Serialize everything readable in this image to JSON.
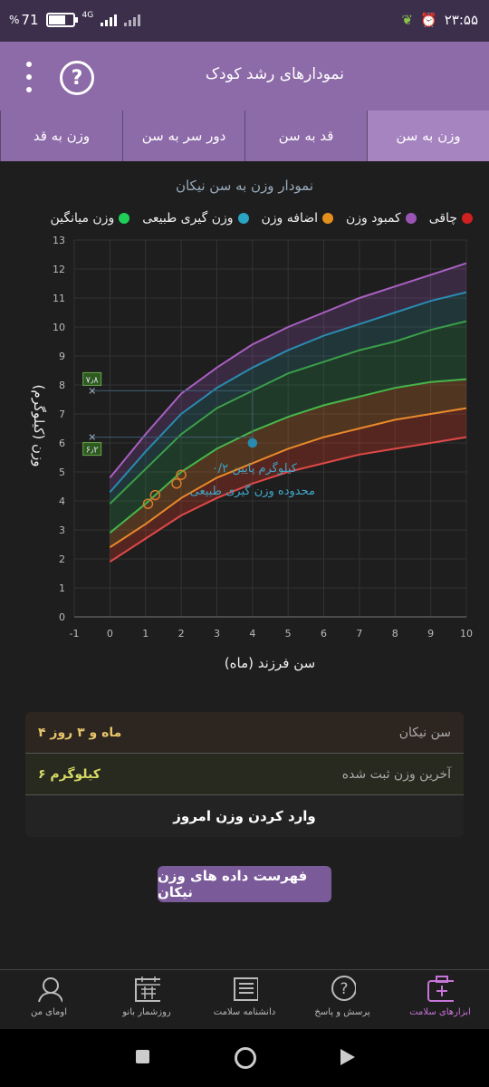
{
  "status": {
    "battery": "71",
    "battery_symbol": "%",
    "network": "4G",
    "clock": "۲۳:۵۵"
  },
  "header": {
    "title": "نمودارهای رشد کودک",
    "help_symbol": "?"
  },
  "tabs": [
    {
      "label": "وزن به سن",
      "active": true
    },
    {
      "label": "قد به سن",
      "active": false
    },
    {
      "label": "دور سر به سن",
      "active": false
    },
    {
      "label": "وزن به قد",
      "active": false
    }
  ],
  "chart": {
    "title": "نمودار وزن به سن نیکان"
  },
  "legend": [
    {
      "label": "چاقی",
      "color": "#d12020"
    },
    {
      "label": "کمبود وزن",
      "color": "#e5901c"
    },
    {
      "label": "اضافه وزن",
      "color": "#2aa4c2"
    },
    {
      "label": "وزن گیری طبیعی",
      "color": "#1fcf57"
    },
    {
      "label": "وزن میانگین",
      "color": "#4a4a4a"
    }
  ],
  "chart_data": {
    "type": "line",
    "xlabel": "سن فرزند (ماه)",
    "ylabel": "وزن (کیلوگرم)",
    "xlim": [
      -1,
      10
    ],
    "ylim": [
      0,
      13
    ],
    "x": [
      0,
      1,
      2,
      3,
      4,
      5,
      6,
      7,
      8,
      9,
      10
    ],
    "series": [
      {
        "color": "#e04848",
        "values": [
          1.9,
          2.7,
          3.5,
          4.1,
          4.6,
          5.0,
          5.3,
          5.6,
          5.8,
          6.0,
          6.2
        ]
      },
      {
        "color": "#e98a2a",
        "values": [
          2.4,
          3.2,
          4.1,
          4.8,
          5.3,
          5.8,
          6.2,
          6.5,
          6.8,
          7.0,
          7.2
        ]
      },
      {
        "color": "#46b64b",
        "values": [
          2.9,
          3.9,
          5.0,
          5.8,
          6.4,
          6.9,
          7.3,
          7.6,
          7.9,
          8.1,
          8.2
        ]
      },
      {
        "color": "#3a9e4a",
        "values": [
          3.9,
          5.1,
          6.3,
          7.2,
          7.8,
          8.4,
          8.8,
          9.2,
          9.5,
          9.9,
          10.2
        ]
      },
      {
        "color": "#2a8bb0",
        "values": [
          4.3,
          5.7,
          7.0,
          7.9,
          8.6,
          9.2,
          9.7,
          10.1,
          10.5,
          10.9,
          11.2
        ]
      },
      {
        "color": "#a960c2",
        "values": [
          4.8,
          6.3,
          7.7,
          8.6,
          9.4,
          10.0,
          10.5,
          11.0,
          11.4,
          11.8,
          12.2
        ]
      }
    ],
    "child_points": {
      "x": [
        1.07,
        1.27,
        1.87,
        2.0,
        4.0
      ],
      "y": [
        3.9,
        4.2,
        4.6,
        4.9,
        6.0
      ]
    },
    "markers": [
      {
        "label": "۷٫۸",
        "value": 7.8
      },
      {
        "label": "۶٫۲",
        "value": 6.2
      }
    ],
    "annotations": [
      "۰/۲ کیلوگرم پایین",
      "محدوده وزن گیری طبیعی"
    ]
  },
  "info": {
    "age_label": "سن نیکان",
    "age_value": "۴ ماه و ۳ روز",
    "weight_label": "آخرین وزن ثبت شده",
    "weight_value": "۶ کیلوگرم",
    "enter_label": "وارد کردن وزن امروز"
  },
  "list_button": "فهرست داده های وزن نیکان",
  "nav": [
    {
      "label": "ابزارهای سلامت",
      "icon": "health-kit-icon",
      "active": true
    },
    {
      "label": "پرسش و پاسخ",
      "icon": "question-bubble-icon",
      "active": false
    },
    {
      "label": "دانشنامه سلامت",
      "icon": "encyclopedia-icon",
      "active": false
    },
    {
      "label": "روزشمار بانو",
      "icon": "calendar-icon",
      "active": false
    },
    {
      "label": "اومای من",
      "icon": "profile-icon",
      "active": false
    }
  ]
}
